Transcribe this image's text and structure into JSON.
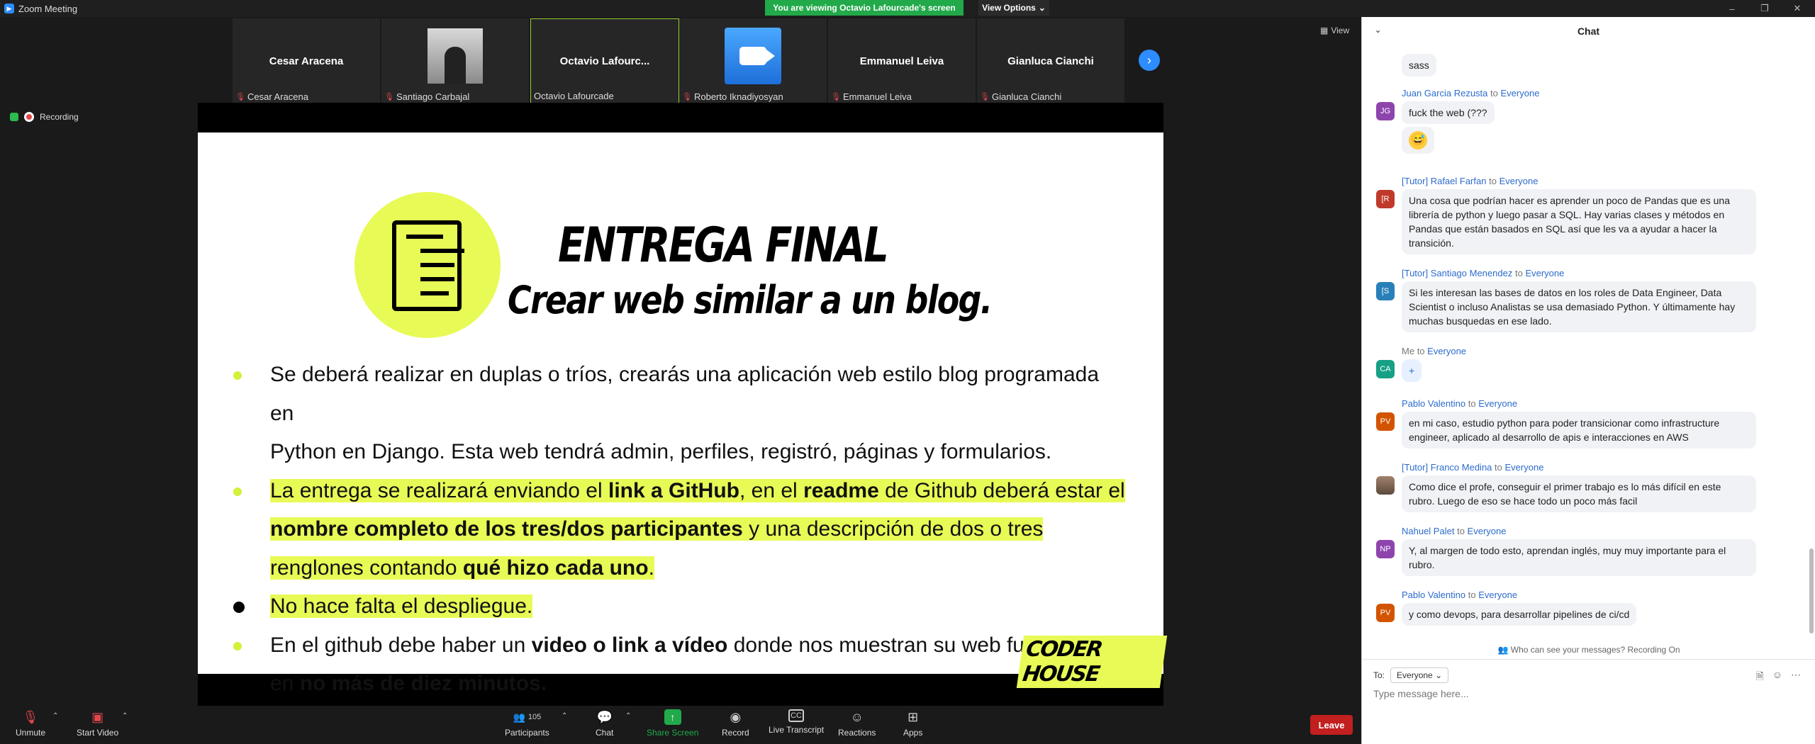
{
  "window": {
    "title": "Zoom Meeting"
  },
  "banner": {
    "text": "You are viewing Octavio Lafourcade's screen",
    "view_options": "View Options"
  },
  "view_label": "View",
  "recording_label": "Recording",
  "participants": [
    {
      "tile": "Cesar Aracena",
      "label": "Cesar Aracena",
      "type": "name"
    },
    {
      "tile": "",
      "label": "Santiago Carbajal",
      "type": "photo"
    },
    {
      "tile": "Octavio  Lafourc...",
      "label": "Octavio Lafourcade",
      "type": "name"
    },
    {
      "tile": "",
      "label": "Roberto Iknadiyosyan",
      "type": "zoom"
    },
    {
      "tile": "Emmanuel Leiva",
      "label": "Emmanuel Leiva",
      "type": "name"
    },
    {
      "tile": "Gianluca Cianchi",
      "label": "Gianluca Cianchi",
      "type": "name"
    }
  ],
  "slide": {
    "title": "ENTREGA FINAL",
    "subtitle": "Crear web similar a un blog.",
    "b1_l1": "Se deberá realizar en  duplas o tríos, crearás una aplicación web estilo blog programada en",
    "b1_l2": "Python en Django. Esta web tendrá admin, perfiles, registró, páginas y formularios.",
    "b2_a": "La entrega se realizará enviando el ",
    "b2_b": "link a GitHub",
    "b2_c": ", en el ",
    "b2_d": "readme",
    "b2_e": " de Github deberá estar el",
    "b2_f": "nombre completo de los tres/dos participantes",
    "b2_g": " y una descripción de dos o tres",
    "b2_h": "renglones contando ",
    "b2_i": "qué hizo cada uno",
    "b2_j": ".",
    "b3": "No hace falta el despliegue.",
    "b4_a": "En el github debe haber un ",
    "b4_b": "video o link a vídeo",
    "b4_c": " donde nos muestran su web funcionando",
    "b4_d": "en ",
    "b4_e": "no más de diez minutos.",
    "brand": "CODER HOUSE"
  },
  "toolbar": {
    "unmute": "Unmute",
    "start_video": "Start Video",
    "participants": "Participants",
    "participants_count": "105",
    "chat": "Chat",
    "share_screen": "Share Screen",
    "record": "Record",
    "live_transcript": "Live Transcript",
    "reactions": "Reactions",
    "apps": "Apps",
    "leave": "Leave"
  },
  "chat": {
    "title": "Chat",
    "messages": [
      {
        "sender": "",
        "to": "",
        "text": "sass",
        "initials": "",
        "color": ""
      },
      {
        "sender": "Juan Garcia Rezusta",
        "to": "Everyone",
        "text": "fuck the web (???",
        "initials": "JG",
        "color": "#8e44ad"
      },
      {
        "sender": "[Tutor] Rafael Farfan",
        "to": "Everyone",
        "text": "Una cosa que podrían hacer es aprender un poco de Pandas que es una librería de python y luego pasar a SQL. Hay varias clases y métodos en Pandas que están basados en SQL así que les va a ayudar a hacer la transición.",
        "initials": "[R",
        "color": "#c0392b"
      },
      {
        "sender": "[Tutor] Santiago Menendez",
        "to": "Everyone",
        "text": "Si les interesan las bases de datos en los roles de Data Engineer, Data Scientist o incluso Analistas se usa demasiado Python. Y últimamente hay muchas busquedas en ese lado.",
        "initials": "[S",
        "color": "#2980b9"
      },
      {
        "sender": "Me",
        "to": "Everyone",
        "text": "+",
        "initials": "CA",
        "color": "#16a085"
      },
      {
        "sender": "Pablo Valentino",
        "to": "Everyone",
        "text": "en mi caso, estudio python para poder transicionar como infrastructure engineer, aplicado al desarrollo de apis e interacciones en AWS",
        "initials": "PV",
        "color": "#d35400"
      },
      {
        "sender": "[Tutor] Franco Medina",
        "to": "Everyone",
        "text": "Como dice el profe, conseguir el primer trabajo es lo más difícil en este rubro. Luego de eso se hace todo un poco más facil",
        "initials": "",
        "color": "#7a6a55"
      },
      {
        "sender": "Nahuel Palet",
        "to": "Everyone",
        "text": "Y, al margen de todo esto, aprendan inglés, muy muy importante para el rubro.",
        "initials": "NP",
        "color": "#8e44ad"
      },
      {
        "sender": "Pablo Valentino",
        "to": "Everyone",
        "text": "y como devops, para desarrollar pipelines de ci/cd",
        "initials": "PV",
        "color": "#d35400"
      }
    ],
    "word_to": "to",
    "privacy": "Who can see your messages? Recording On",
    "to_label": "To:",
    "to_value": "Everyone",
    "placeholder": "Type message here..."
  }
}
